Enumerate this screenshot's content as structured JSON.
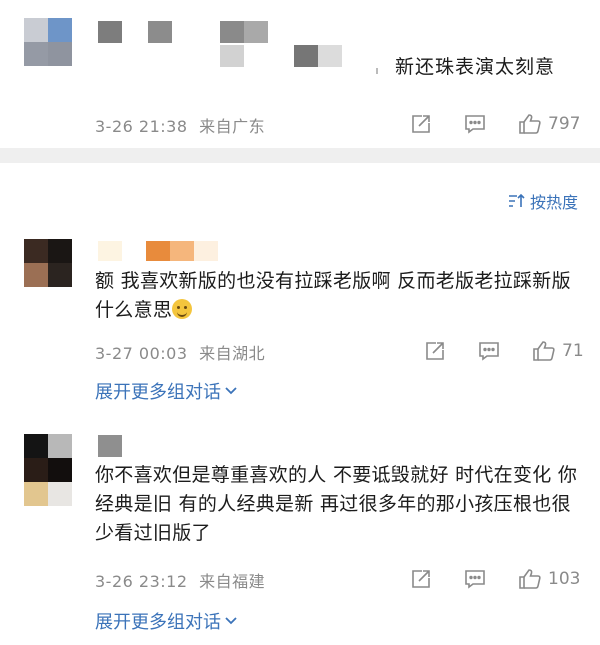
{
  "top_comment": {
    "text": "新还珠表演太刻意",
    "time": "3-26 21:38",
    "location": "来自广东",
    "like_count": "797"
  },
  "sort": {
    "label": "按热度",
    "icon": "sort-icon"
  },
  "comments": [
    {
      "text": "额 我喜欢新版的也没有拉踩老版啊 反而老版老拉踩新版什么意思",
      "time": "3-27 00:03",
      "location": "来自湖北",
      "like_count": "71",
      "expand_label": "展开更多组对话"
    },
    {
      "text": "你不喜欢但是尊重喜欢的人 不要诋毁就好 时代在变化 你经典是旧 有的人经典是新 再过很多年的那小孩压根也很少看过旧版了",
      "time": "3-26 23:12",
      "location": "来自福建",
      "like_count": "103",
      "expand_label": "展开更多组对话"
    }
  ],
  "colors": {
    "link": "#3b73b9",
    "meta": "#8a8a8a",
    "divider": "#efefef"
  }
}
